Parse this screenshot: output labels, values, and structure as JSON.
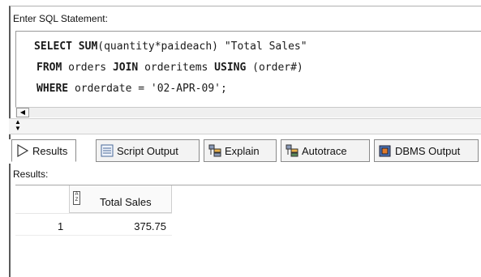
{
  "prompt_label": "Enter SQL Statement:",
  "sql": {
    "line1": {
      "kw1": "SELECT",
      "kw2": "SUM",
      "rest": "(quantity*paideach) \"Total Sales\""
    },
    "line2": {
      "kw1": "FROM",
      "mid": " orders ",
      "kw2": "JOIN",
      "mid2": " orderitems ",
      "kw3": "USING",
      "rest": " (order#)"
    },
    "line3": {
      "kw1": "WHERE",
      "rest": " orderdate = '02-APR-09';"
    }
  },
  "tabs": [
    {
      "label": "Results",
      "icon": "play-arrow-icon"
    },
    {
      "label": "Script Output",
      "icon": "document-icon"
    },
    {
      "label": "Explain",
      "icon": "explain-plan-icon"
    },
    {
      "label": "Autotrace",
      "icon": "autotrace-icon"
    },
    {
      "label": "DBMS Output",
      "icon": "dbms-output-icon"
    }
  ],
  "results_label": "Results:",
  "grid": {
    "column_header": "Total Sales",
    "sort_icon_text": "A Z",
    "rows": [
      {
        "num": "1",
        "value": "375.75"
      }
    ]
  }
}
